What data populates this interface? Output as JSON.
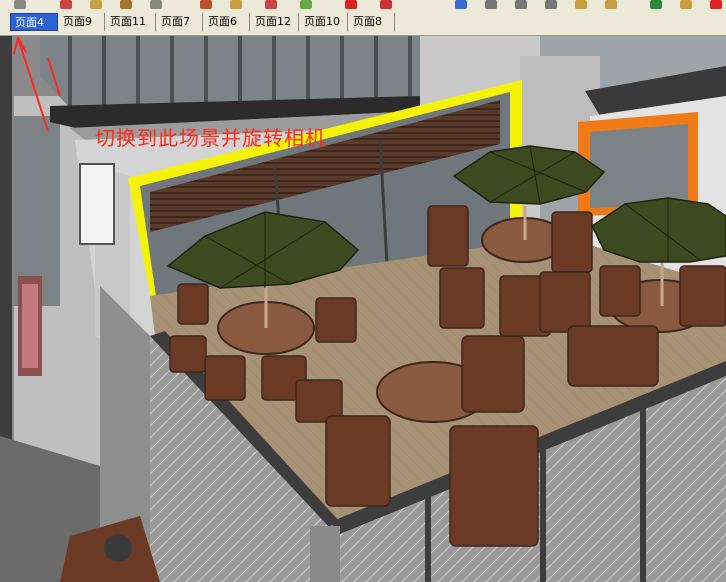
{
  "tabs": [
    {
      "label": "页面4",
      "active": true
    },
    {
      "label": "页面9"
    },
    {
      "label": "页面11"
    },
    {
      "label": "页面7"
    },
    {
      "label": "页面6"
    },
    {
      "label": "页面12"
    },
    {
      "label": "页面10"
    },
    {
      "label": "页面8"
    }
  ],
  "annotation": {
    "text": "切换到此场景并旋转相机",
    "color": "#ff2a1a"
  },
  "colors": {
    "accent_yellow": "#f5f20a",
    "accent_orange": "#f07a16",
    "umbrella_green": "#3d4a1f",
    "furniture_brown": "#6b3a25",
    "deck_tan": "#a89275",
    "tab_active": "#2b63d6"
  },
  "scene": {
    "type": "3d-model-viewport",
    "description_icon": "sketchup-scene"
  }
}
